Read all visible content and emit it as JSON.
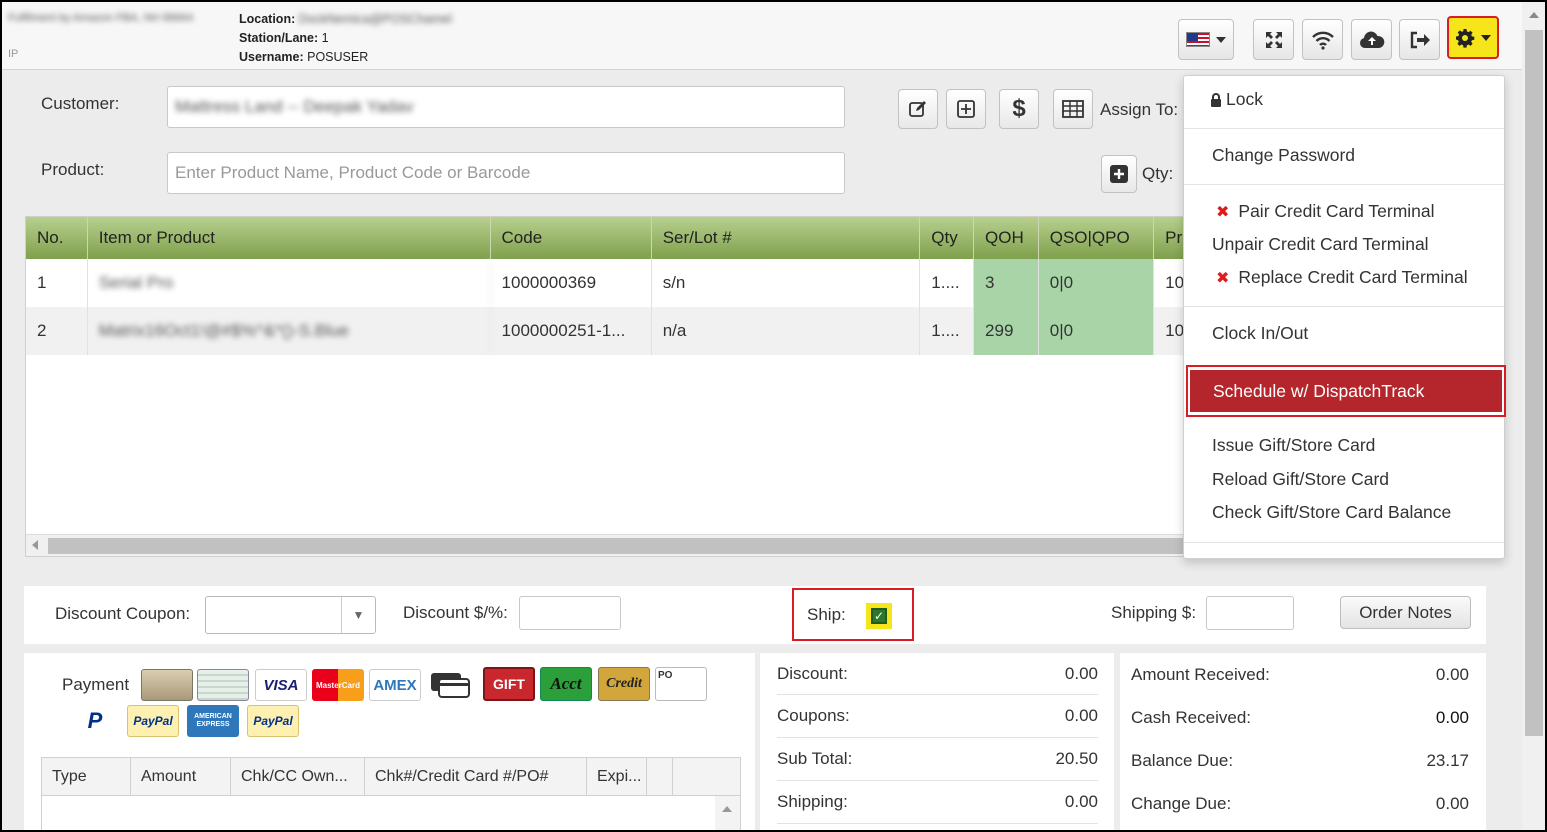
{
  "header": {
    "store_name": "Fulfilment by Amazon FBA, NH 88664",
    "store_sub": "IP",
    "location_label": "Location:",
    "location_value": "DockNemica@POSChamel",
    "station_label": "Station/Lane:",
    "station_value": "1",
    "username_label": "Username:",
    "username_value": "POSUSER",
    "toolbar_icons": [
      "us-flag-icon",
      "fullscreen-icon",
      "wifi-icon",
      "cloud-upload-icon",
      "logout-icon",
      "gear-icon"
    ]
  },
  "form": {
    "customer_label": "Customer:",
    "customer_value": "Mattress Land -- Deepak Yadav",
    "product_label": "Product:",
    "product_placeholder": "Enter Product Name, Product Code or Barcode",
    "assign_label": "Assign To:",
    "qty_label": "Qty:"
  },
  "grid": {
    "columns": [
      "No.",
      "Item or Product",
      "Code",
      "Ser/Lot #",
      "Qty",
      "QOH",
      "QSO|QPO",
      "Pr"
    ],
    "rows": [
      {
        "no": "1",
        "item": "Serial Pro",
        "code": "1000000369",
        "ser": "s/n",
        "qty": "1....",
        "qoh": "3",
        "qso": "0|0",
        "pr": "10"
      },
      {
        "no": "2",
        "item": "Matrix16Oct1!@#$%^&*()-S.Blue",
        "code": "1000000251-1...",
        "ser": "n/a",
        "qty": "1....",
        "qoh": "299",
        "qso": "0|0",
        "pr": "10"
      }
    ]
  },
  "shipbar": {
    "discount_coupon_label": "Discount Coupon:",
    "discount_label": "Discount $/%:",
    "ship_label": "Ship:",
    "shipping_label": "Shipping $:",
    "order_notes": "Order Notes"
  },
  "payment": {
    "label": "Payment",
    "methods": [
      {
        "name": "cash",
        "text": ""
      },
      {
        "name": "check",
        "text": ""
      },
      {
        "name": "visa",
        "text": "VISA"
      },
      {
        "name": "mastercard",
        "text": "MasterCard"
      },
      {
        "name": "amex",
        "text": "AMEX"
      },
      {
        "name": "cards",
        "text": ""
      },
      {
        "name": "gift",
        "text": "GIFT"
      },
      {
        "name": "acct",
        "text": "Acct"
      },
      {
        "name": "credit",
        "text": "Credit"
      },
      {
        "name": "po",
        "text": "PO"
      },
      {
        "name": "paypal-p",
        "text": "P"
      },
      {
        "name": "paypal",
        "text": "PayPal"
      },
      {
        "name": "amex-express",
        "text": "AMERICAN EXPRESS"
      },
      {
        "name": "paypal2",
        "text": "PayPal"
      }
    ],
    "columns": [
      "Type",
      "Amount",
      "Chk/CC Own...",
      "Chk#/Credit Card #/PO#",
      "Expi..."
    ]
  },
  "totals_mid": [
    {
      "label": "Discount:",
      "value": "0.00"
    },
    {
      "label": "Coupons:",
      "value": "0.00"
    },
    {
      "label": "Sub Total:",
      "value": "20.50"
    },
    {
      "label": "Shipping:",
      "value": "0.00"
    }
  ],
  "totals_right": [
    {
      "label": "Amount Received:",
      "value": "0.00"
    },
    {
      "label": "Cash Received:",
      "value": "0.00"
    },
    {
      "label": "Balance Due:",
      "value": "23.17"
    },
    {
      "label": "Change Due:",
      "value": "0.00"
    }
  ],
  "menu": {
    "lock": "Lock",
    "change_password": "Change Password",
    "pair_terminal": "Pair Credit Card Terminal",
    "unpair_terminal": "Unpair Credit Card Terminal",
    "replace_terminal": "Replace Credit Card Terminal",
    "clock": "Clock In/Out",
    "dispatch": "Schedule w/ DispatchTrack",
    "issue_gift": "Issue Gift/Store Card",
    "reload_gift": "Reload Gift/Store Card",
    "check_gift": "Check Gift/Store Card Balance"
  },
  "colors": {
    "accent_red": "#d81e24",
    "highlight_yellow": "#f6e51b",
    "menu_highlight": "#b5262c",
    "grid_header_green": "#7fa04c",
    "stock_green": "#a8d4a8"
  }
}
